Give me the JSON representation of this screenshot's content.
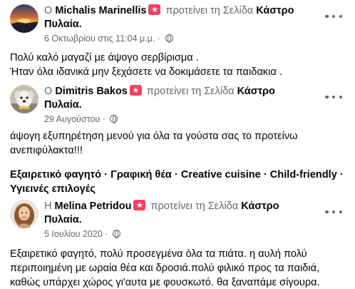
{
  "reviews": [
    {
      "author": "Michalis Marinellis",
      "prefix": "Ο",
      "action": "προτείνει τη Σελίδα",
      "page": "Κάστρο",
      "page2": "Πυλαία.",
      "date": "6 Οκτωβρίου στις 11:04 μ.μ.",
      "date_sep": "·",
      "avatar": "sunset-avatar",
      "lines": [
        "Πολύ καλό μαγαζί με άψογο σερβίρισμα .",
        "Ήταν όλα ιδανικά μην ξεχάσετε να δοκιμάσετε τα παιδακια ."
      ]
    },
    {
      "author": "Dimitris Bakos",
      "prefix": "Ο",
      "action": "προτείνει τη Σελίδα",
      "page": "Κάστρο",
      "page2": "Πυλαία.",
      "date": "29 Αυγούστου",
      "date_sep": "·",
      "avatar": "dog-avatar",
      "lines": [
        "άψογη εξυπηρέτηση μενού για όλα τα γούστα σας το προτείνω",
        "ανεπιφύλακτα!!!"
      ],
      "tags_line1": "Εξαιρετικό φαγητό · Γραφική θέα · Creative cuisine · Child-friendly ·",
      "tags_line2": "Υγιεινές επιλογές"
    },
    {
      "author": "Melina Petridou",
      "prefix": "Η",
      "action": "προτείνει τη Σελίδα",
      "page": "Κάστρο",
      "page2": "Πυλαία.",
      "date": "5 Ιουλίου 2020",
      "date_sep": "·",
      "avatar": "portrait-avatar",
      "lines": [
        "Εξαιρετικό φαγητό, πολύ προσεγμένα όλα τα πιάτα. η αυλή πολύ",
        "περιποιημένη με ωραία θέα και δροσιά.πολύ φιλικό προς τα παιδιά,",
        "καθώς υπάρχει χώρος γι'αυτα με φουσκωτό. θα ξαναπάμε σίγουρα."
      ]
    }
  ],
  "colors": {
    "text": "#050505",
    "secondary": "#65676b",
    "recommend": "#f3425f"
  }
}
